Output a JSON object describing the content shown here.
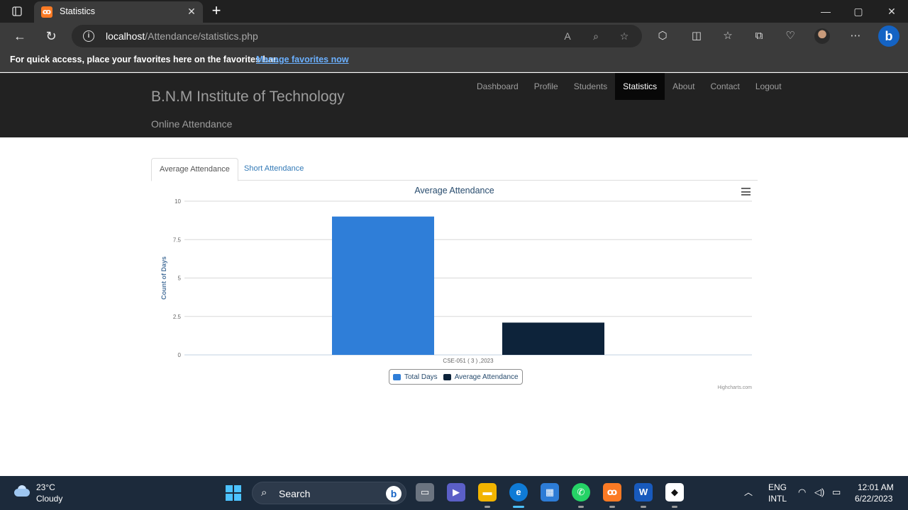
{
  "browser": {
    "tab_title": "Statistics",
    "tab_favicon": "xampp-icon",
    "url_host": "localhost",
    "url_path": "/Attendance/statistics.php",
    "favorites_prompt": "For quick access, place your favorites here on the favorites bar.",
    "favorites_link": "Manage favorites now"
  },
  "site": {
    "brand": "B.N.M Institute of Technology",
    "tagline": "Online Attendance",
    "menu": [
      {
        "label": "Dashboard"
      },
      {
        "label": "Profile"
      },
      {
        "label": "Students"
      },
      {
        "label": "Statistics",
        "active": true
      },
      {
        "label": "About"
      },
      {
        "label": "Contact"
      },
      {
        "label": "Logout"
      }
    ]
  },
  "page_tabs": [
    {
      "label": "Average Attendance",
      "active": true
    },
    {
      "label": "Short Attendance",
      "active": false
    }
  ],
  "chart_data": {
    "type": "bar",
    "title": "Average Attendance",
    "xlabel": "",
    "ylabel": "Count of Days",
    "categories": [
      "CSE-051 ( 3 ) ,2023"
    ],
    "ylim": [
      0,
      10
    ],
    "yticks": [
      "0",
      "2.5",
      "5",
      "7.5",
      "10"
    ],
    "grid": true,
    "legend_position": "bottom-center",
    "series": [
      {
        "name": "Total Days",
        "values": [
          9
        ],
        "color": "#2f7ed8"
      },
      {
        "name": "Average Attendance",
        "values": [
          2.1
        ],
        "color": "#0d233a"
      }
    ],
    "credits": "Highcharts.com"
  },
  "taskbar": {
    "weather_temp": "23°C",
    "weather_desc": "Cloudy",
    "search_label": "Search",
    "lang_line1": "ENG",
    "lang_line2": "INTL",
    "time": "12:01 AM",
    "date": "6/22/2023"
  }
}
